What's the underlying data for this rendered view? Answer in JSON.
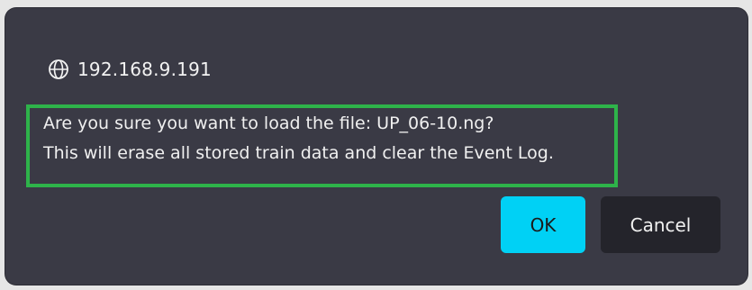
{
  "dialog": {
    "origin": "192.168.9.191",
    "origin_icon": "globe-icon",
    "message_line1": "Are you sure you want to load the file: UP_06-10.ng?",
    "message_line2": "This will erase all stored train data and clear the Event Log.",
    "ok_label": "OK",
    "cancel_label": "Cancel"
  },
  "colors": {
    "dialog_bg": "#3a3a45",
    "highlight_border": "#2eb34a",
    "ok_bg": "#00d1f5",
    "cancel_bg": "#24242b"
  }
}
